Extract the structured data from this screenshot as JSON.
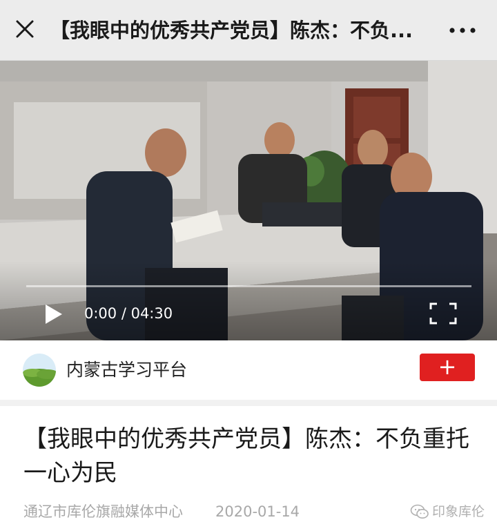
{
  "header": {
    "title": "【我眼中的优秀共产党员】陈杰：不负...",
    "close_icon": "close-icon",
    "more_icon": "more-dots-icon"
  },
  "video": {
    "current_time": "0:00",
    "duration": "04:30",
    "time_display": "0:00 / 04:30",
    "progress": 0.0,
    "play_icon": "play-icon",
    "fullscreen_icon": "fullscreen-icon"
  },
  "account": {
    "name": "内蒙古学习平台",
    "follow_label": "+",
    "follow_color": "#e02020"
  },
  "article": {
    "title": "【我眼中的优秀共产党员】陈杰：不负重托 一心为民",
    "source": "通辽市库伦旗融媒体中心",
    "date": "2020-01-14"
  },
  "watermark": {
    "text": "印象库伦",
    "icon": "wechat-icon"
  }
}
